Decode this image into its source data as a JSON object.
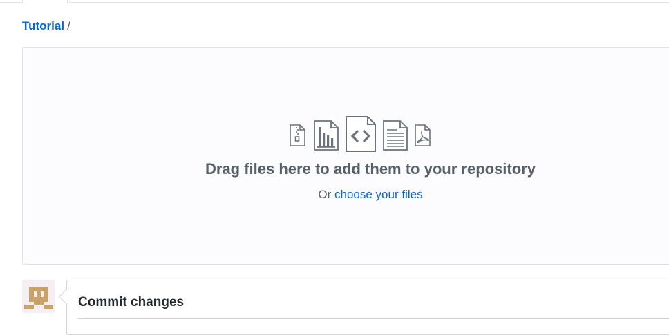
{
  "breadcrumb": {
    "repo": "Tutorial",
    "separator": "/"
  },
  "dropzone": {
    "title": "Drag files here to add them to your repository",
    "prefix": "Or",
    "link": "choose your files",
    "icons": [
      "zip-file-icon",
      "chart-file-icon",
      "code-file-icon",
      "text-file-icon",
      "pdf-file-icon"
    ]
  },
  "commit": {
    "title": "Commit changes"
  },
  "colors": {
    "link": "#0366d6",
    "muted": "#586069",
    "dropzone_bg": "#fcfbfd",
    "avatar": "#c7a26a"
  }
}
